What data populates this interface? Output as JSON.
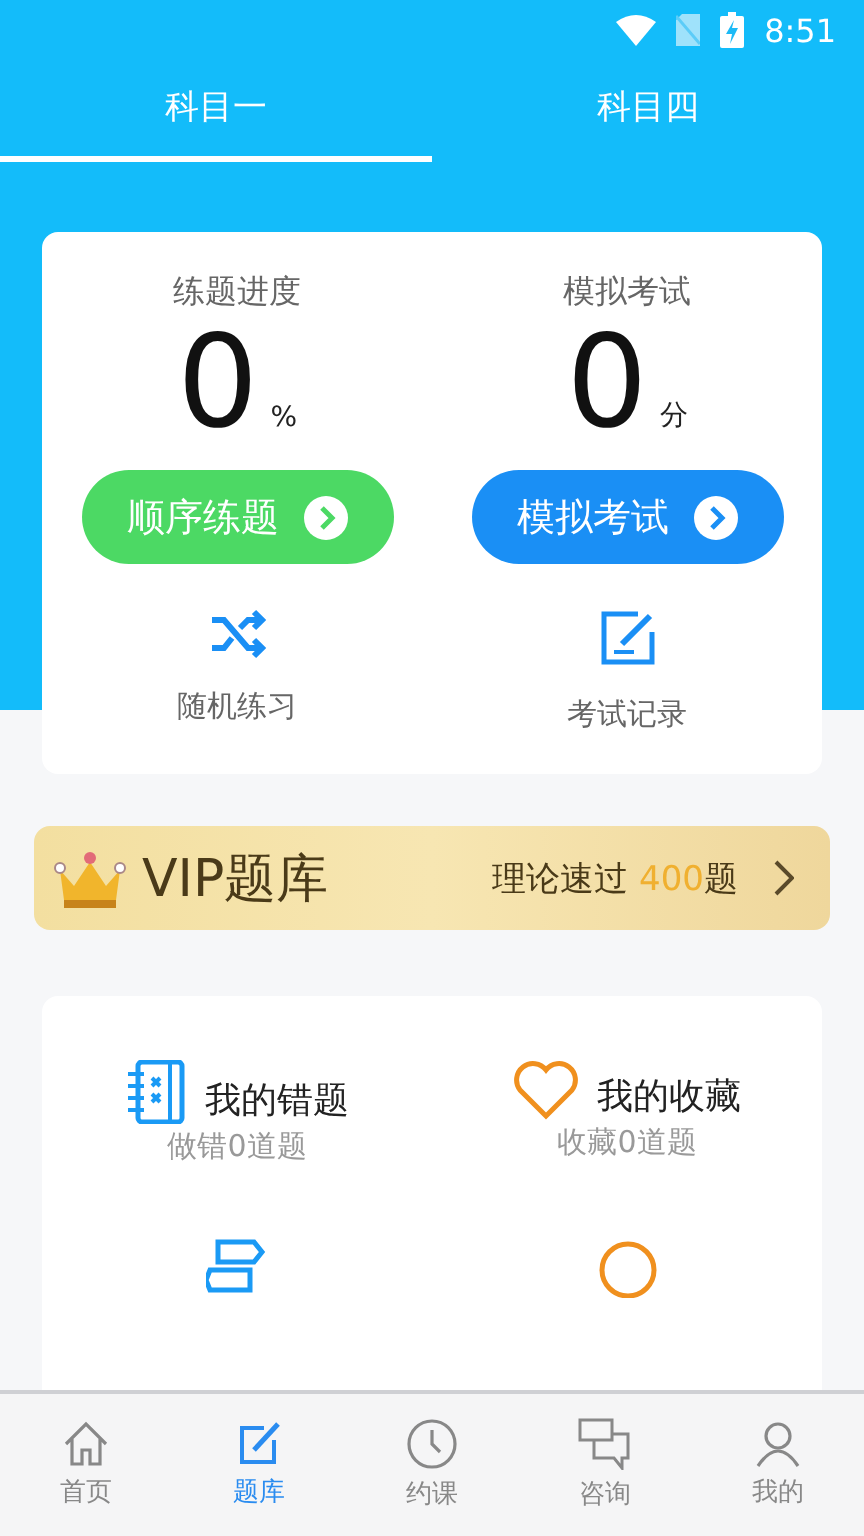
{
  "status_bar": {
    "time": "8:51"
  },
  "tabs": [
    {
      "label": "科目一",
      "selected": true
    },
    {
      "label": "科目四",
      "selected": false
    }
  ],
  "stats": [
    {
      "label": "练题进度",
      "value": "0",
      "unit": "%"
    },
    {
      "label": "模拟考试",
      "value": "0",
      "unit": "分"
    }
  ],
  "actions": [
    {
      "label": "顺序练题",
      "color": "#4cd964"
    },
    {
      "label": "模拟考试",
      "color": "#1a8ff5"
    }
  ],
  "shortcuts": [
    {
      "kind": "shuffle",
      "label": "随机练习"
    },
    {
      "kind": "edit",
      "label": "考试记录"
    }
  ],
  "vip": {
    "title": "VIP题库",
    "prefix": "理论速过 ",
    "count": "400",
    "suffix": "题"
  },
  "features": [
    {
      "kind": "notebook",
      "title": "我的错题",
      "subtitle": "做错0道题"
    },
    {
      "kind": "heart",
      "title": "我的收藏",
      "subtitle": "收藏0道题"
    }
  ],
  "nav": [
    {
      "kind": "home",
      "label": "首页",
      "selected": false
    },
    {
      "kind": "edit",
      "label": "题库",
      "selected": true
    },
    {
      "kind": "clock",
      "label": "约课",
      "selected": false
    },
    {
      "kind": "chat",
      "label": "咨询",
      "selected": false
    },
    {
      "kind": "user",
      "label": "我的",
      "selected": false
    }
  ]
}
